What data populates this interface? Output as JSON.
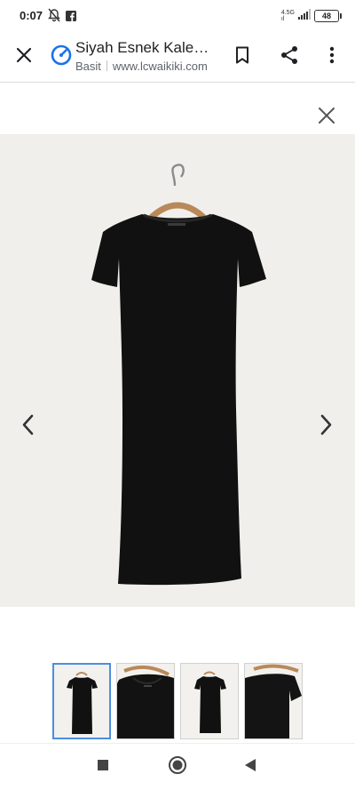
{
  "status_bar": {
    "time": "0:07",
    "network_label_top": "4.5G",
    "network_label_bottom": "ıl",
    "battery_level": "48",
    "icons": [
      "mute-bell-icon",
      "facebook-icon",
      "signal-icon",
      "battery-icon"
    ]
  },
  "toolbar": {
    "title": "Siyah Esnek Kale…",
    "subtitle_label": "Basit",
    "url": "www.lcwaikiki.com",
    "icons": [
      "close-icon",
      "site-gauge-icon",
      "bookmark-icon",
      "share-icon",
      "more-vert-icon"
    ],
    "accent_color": "#1a73e8"
  },
  "viewer": {
    "icons": [
      "close-icon",
      "chevron-left-icon",
      "chevron-right-icon"
    ],
    "image_subject": "black short-sleeve midi dress on wooden hanger",
    "thumbnails_count": 4,
    "active_thumbnail": 1,
    "active_border_color": "#4a8fe0"
  },
  "nav_bar": {
    "icons": [
      "recents-square-icon",
      "home-circle-icon",
      "back-triangle-icon"
    ]
  }
}
